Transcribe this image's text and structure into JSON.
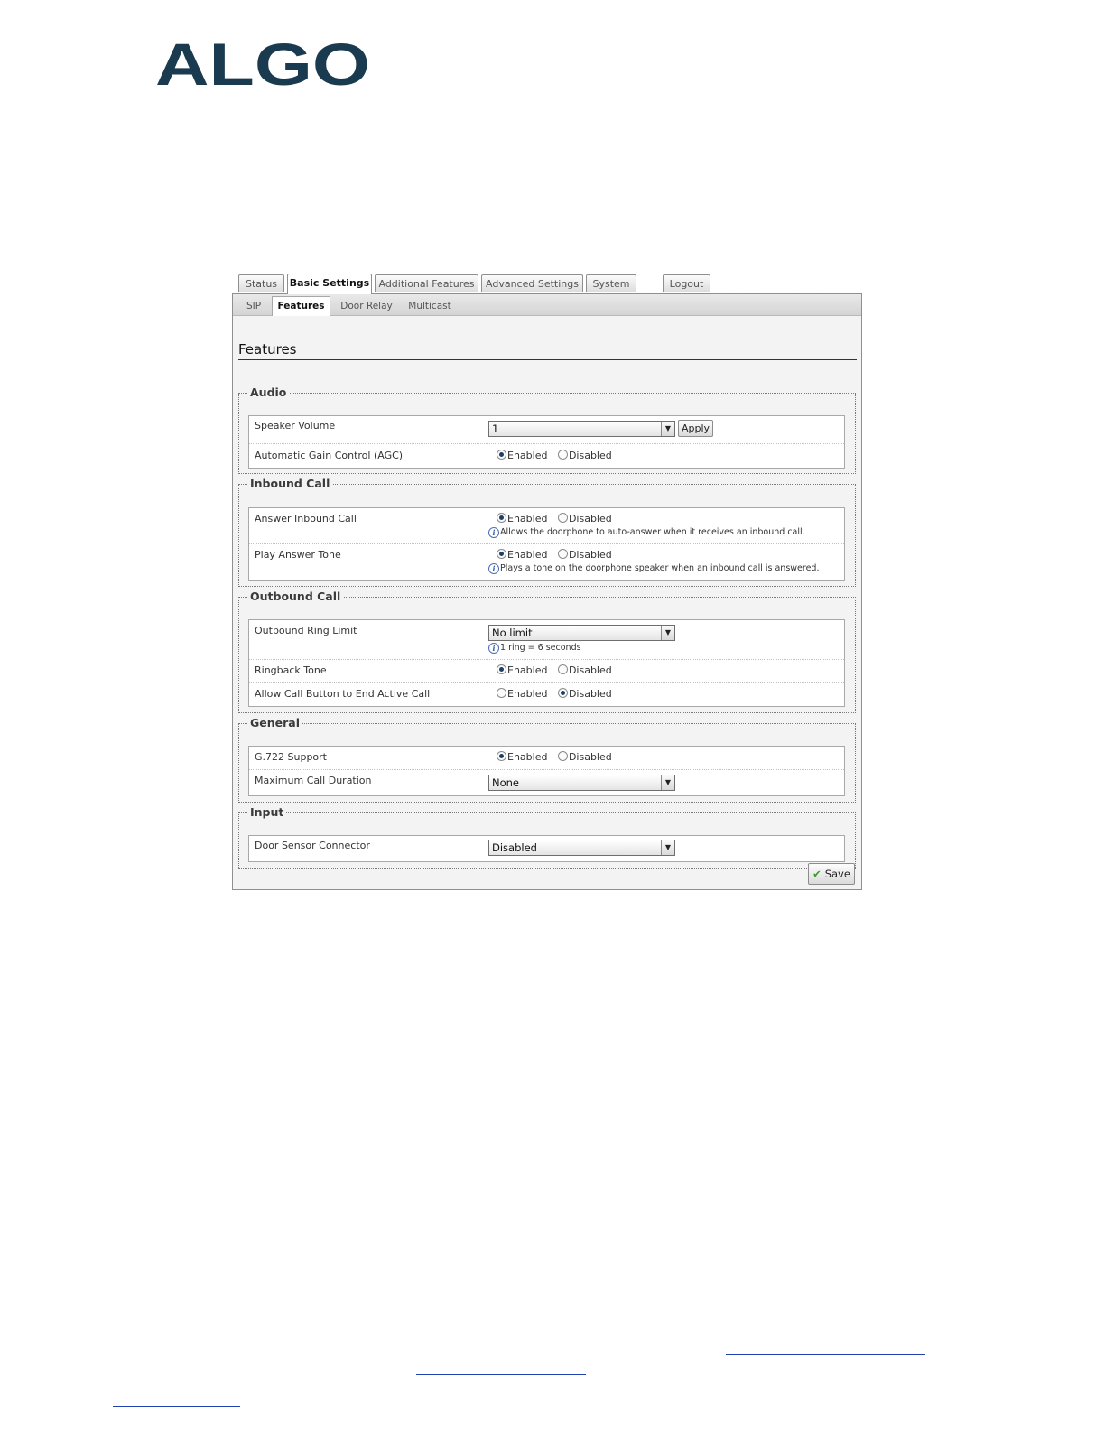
{
  "brand": {
    "logo_text": "ALGO",
    "color": "#1a3a4f"
  },
  "main_tabs": [
    {
      "label": "Status"
    },
    {
      "label": "Basic Settings",
      "active": true
    },
    {
      "label": "Additional Features"
    },
    {
      "label": "Advanced Settings"
    },
    {
      "label": "System"
    },
    {
      "label": "Logout"
    }
  ],
  "sub_tabs": [
    {
      "label": "SIP"
    },
    {
      "label": "Features",
      "active": true
    },
    {
      "label": "Door Relay"
    },
    {
      "label": "Multicast"
    }
  ],
  "page_title": "Features",
  "audio": {
    "legend": "Audio",
    "speaker_volume": {
      "label": "Speaker Volume",
      "value": "1",
      "apply_label": "Apply"
    },
    "agc": {
      "label": "Automatic Gain Control (AGC)",
      "enabled_label": "Enabled",
      "disabled_label": "Disabled",
      "selected": "Enabled"
    }
  },
  "inbound": {
    "legend": "Inbound Call",
    "answer": {
      "label": "Answer Inbound Call",
      "enabled_label": "Enabled",
      "disabled_label": "Disabled",
      "selected": "Enabled",
      "hint": "Allows the doorphone to auto-answer when it receives an inbound call."
    },
    "tone": {
      "label": "Play Answer Tone",
      "enabled_label": "Enabled",
      "disabled_label": "Disabled",
      "selected": "Enabled",
      "hint": "Plays a tone on the doorphone speaker when an inbound call is answered."
    }
  },
  "outbound": {
    "legend": "Outbound Call",
    "ring_limit": {
      "label": "Outbound Ring Limit",
      "value": "No limit",
      "hint": "1 ring = 6 seconds"
    },
    "ringback": {
      "label": "Ringback Tone",
      "enabled_label": "Enabled",
      "disabled_label": "Disabled",
      "selected": "Enabled"
    },
    "end_call": {
      "label": "Allow Call Button to End Active Call",
      "enabled_label": "Enabled",
      "disabled_label": "Disabled",
      "selected": "Disabled"
    }
  },
  "general": {
    "legend": "General",
    "g722": {
      "label": "G.722 Support",
      "enabled_label": "Enabled",
      "disabled_label": "Disabled",
      "selected": "Enabled"
    },
    "max_duration": {
      "label": "Maximum Call Duration",
      "value": "None"
    }
  },
  "input": {
    "legend": "Input",
    "door_sensor": {
      "label": "Door Sensor Connector",
      "value": "Disabled"
    }
  },
  "save_label": "Save",
  "info_glyph": "i",
  "dropdown_glyph": "▼",
  "save_glyph": "✔"
}
